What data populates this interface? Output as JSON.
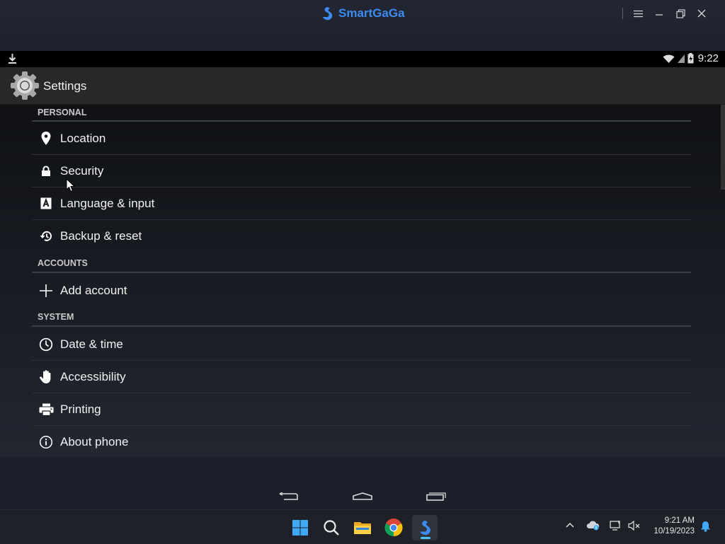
{
  "emulator": {
    "app_name": "SmartGaGa",
    "controls": [
      "menu-icon",
      "minimize-icon",
      "restore-icon",
      "close-icon"
    ]
  },
  "statusbar": {
    "time": "9:22"
  },
  "actionbar": {
    "title": "Settings"
  },
  "sections": [
    {
      "header": "PERSONAL",
      "items": [
        {
          "label": "Location",
          "icon": "location-pin-icon"
        },
        {
          "label": "Security",
          "icon": "lock-icon"
        },
        {
          "label": "Language & input",
          "icon": "language-icon"
        },
        {
          "label": "Backup & reset",
          "icon": "backup-reset-icon"
        }
      ]
    },
    {
      "header": "ACCOUNTS",
      "items": [
        {
          "label": "Add account",
          "icon": "plus-icon"
        }
      ]
    },
    {
      "header": "SYSTEM",
      "items": [
        {
          "label": "Date & time",
          "icon": "clock-icon"
        },
        {
          "label": "Accessibility",
          "icon": "hand-icon"
        },
        {
          "label": "Printing",
          "icon": "printer-icon"
        },
        {
          "label": "About phone",
          "icon": "info-icon"
        }
      ]
    }
  ],
  "taskbar": {
    "apps": [
      "windows-start-icon",
      "search-icon",
      "file-explorer-icon",
      "chrome-icon",
      "smartgaga-icon"
    ],
    "time": "9:21 AM",
    "date": "10/19/2023"
  },
  "colors": {
    "brand": "#3d8bf0",
    "accent": "#4fc0ff"
  }
}
